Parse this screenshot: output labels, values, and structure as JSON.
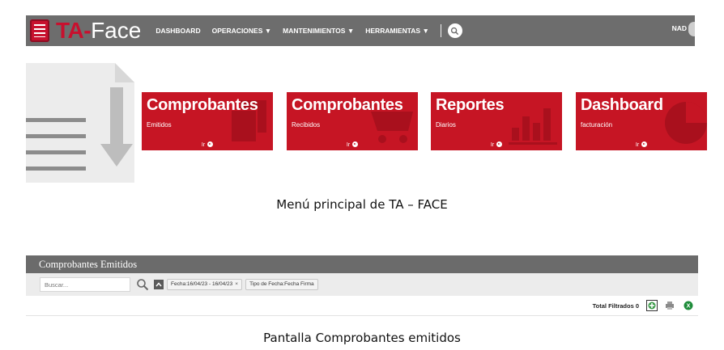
{
  "navbar": {
    "logo_ta": "TA-",
    "logo_face": "Face",
    "items": [
      "DASHBOARD",
      "OPERACIONES ▼",
      "MANTENIMIENTOS ▼",
      "HERRAMIENTAS ▼"
    ],
    "user": "NAD",
    "icons": [
      "document-logo-icon",
      "search-icon"
    ]
  },
  "tiles": [
    {
      "title": "Comprobantes",
      "subtitle": "Emitidos",
      "link": "Ir",
      "icon": "copy-documents-icon"
    },
    {
      "title": "Comprobantes",
      "subtitle": "Recibidos",
      "link": "Ir",
      "icon": "cart-icon"
    },
    {
      "title": "Reportes",
      "subtitle": "Diarios",
      "link": "Ir",
      "icon": "bar-chart-icon"
    },
    {
      "title": "Dashboard",
      "subtitle": "facturación",
      "link": "Ir",
      "icon": "pie-chart-icon"
    }
  ],
  "captions": {
    "menu": "Menú principal de TA – FACE",
    "emitidos": "Pantalla Comprobantes emitidos"
  },
  "emitidos": {
    "title": "Comprobantes Emitidos",
    "search_placeholder": "Buscar...",
    "filters": [
      "Fecha:16/04/23 - 16/04/23",
      "Tipo de Fecha:Fecha Firma"
    ],
    "chip_close": "×",
    "total_label": "Total Filtrados 0",
    "toolbar_icons": [
      "add-icon",
      "print-icon",
      "excel-icon"
    ]
  },
  "colors": {
    "brand_red": "#c61524",
    "navbar_gray": "#6d6d6d",
    "excel_green": "#1e8c3a"
  }
}
